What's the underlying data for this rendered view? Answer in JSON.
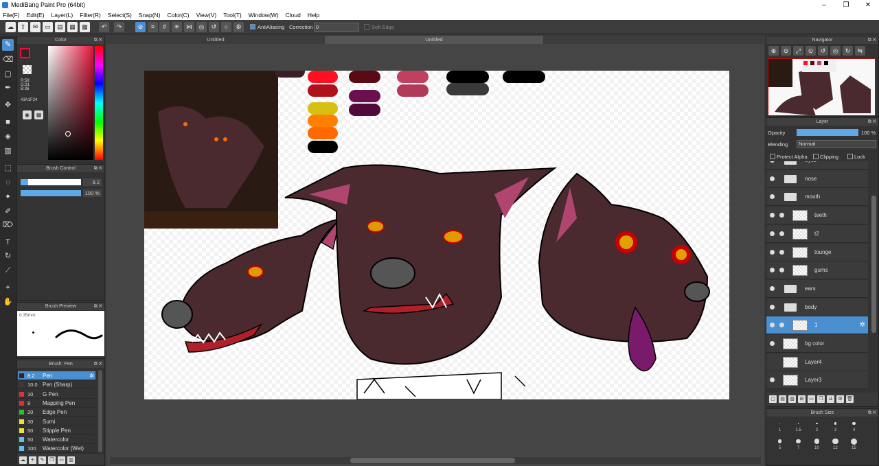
{
  "window": {
    "title": "MediBang Paint Pro (64bit)",
    "controls": [
      "–",
      "❐",
      "✕"
    ]
  },
  "menu": [
    "File(F)",
    "Edit(E)",
    "Layer(L)",
    "Filter(R)",
    "Select(S)",
    "Snap(N)",
    "Color(C)",
    "View(V)",
    "Tool(T)",
    "Window(W)",
    "Cloud",
    "Help"
  ],
  "toolbar": {
    "antialias_label": "AntiAliasing",
    "correction_label": "Correction",
    "correction_value": "0",
    "soft_edge_label": "Soft Edge"
  },
  "color_panel": {
    "title": "Color",
    "r": "R:58",
    "g": "G:31",
    "b": "B:36",
    "hex": "#3A1F24",
    "fg_color": "#3a1f24"
  },
  "brush_control": {
    "title": "Brush Control",
    "size": "8.2",
    "opacity": "100 %",
    "size_frac": 0.12,
    "opacity_frac": 1.0
  },
  "brush_preview": {
    "title": "Brush Preview",
    "size_label": "0.35mm"
  },
  "brush_list": {
    "title": "Brush: Pen",
    "items": [
      {
        "num": "8.2",
        "name": "Pen",
        "color": "#3a1f24",
        "selected": true
      },
      {
        "num": "10.0",
        "name": "Pen (Sharp)",
        "color": "#3a3a3a"
      },
      {
        "num": "10",
        "name": "G Pen",
        "color": "#e03030"
      },
      {
        "num": "8",
        "name": "Mapping Pen",
        "color": "#e03030"
      },
      {
        "num": "20",
        "name": "Edge Pen",
        "color": "#30c030"
      },
      {
        "num": "30",
        "name": "Sumi",
        "color": "#f0e030"
      },
      {
        "num": "50",
        "name": "Stipple Pen",
        "color": "#f0e030"
      },
      {
        "num": "50",
        "name": "Watercolor",
        "color": "#60c0f0"
      },
      {
        "num": "100",
        "name": "Watercolor (Wet)",
        "color": "#60c0f0"
      }
    ]
  },
  "tabs": [
    "Untitled",
    "Untitled"
  ],
  "palette": [
    "#3a1f24",
    "#ff1020",
    "#b0101a",
    "#d8c010",
    "#ff8000",
    "#ff6a00",
    "#000000",
    "#5a0a14",
    "#6a1050",
    "#500a3a",
    "#c04060",
    "#b03a58",
    "#000000",
    "#3a3a3a",
    "#000000"
  ],
  "navigator": {
    "title": "Navigator"
  },
  "layer_panel": {
    "title": "Layer",
    "opacity_label": "Opacity",
    "opacity_value": "100 %",
    "blending_label": "Blending",
    "blending_value": "Normal",
    "protect_alpha": "Protect Alpha",
    "clipping": "Clipping",
    "lock": "Lock",
    "layers": [
      {
        "name": "eyes",
        "type": "folder",
        "indent": 0
      },
      {
        "name": "nose",
        "type": "folder",
        "indent": 0
      },
      {
        "name": "mouth",
        "type": "folder",
        "indent": 0
      },
      {
        "name": "teeth",
        "type": "layer",
        "indent": 1
      },
      {
        "name": "t2",
        "type": "layer",
        "indent": 1
      },
      {
        "name": "tounge",
        "type": "layer",
        "indent": 1
      },
      {
        "name": "gums",
        "type": "layer",
        "indent": 1
      },
      {
        "name": "ears",
        "type": "folder",
        "indent": 0
      },
      {
        "name": "body",
        "type": "folder",
        "indent": 0
      },
      {
        "name": "1",
        "type": "layer",
        "indent": 1,
        "selected": true
      },
      {
        "name": "bg color",
        "type": "layer",
        "indent": 0
      },
      {
        "name": "Layer4",
        "type": "layer",
        "indent": 0
      },
      {
        "name": "Layer3",
        "type": "layer",
        "indent": 0
      }
    ]
  },
  "brush_size": {
    "title": "Brush Size",
    "sizes": [
      "1",
      "1.5",
      "2",
      "3",
      "4",
      "5",
      "7",
      "10",
      "12",
      "15"
    ]
  }
}
